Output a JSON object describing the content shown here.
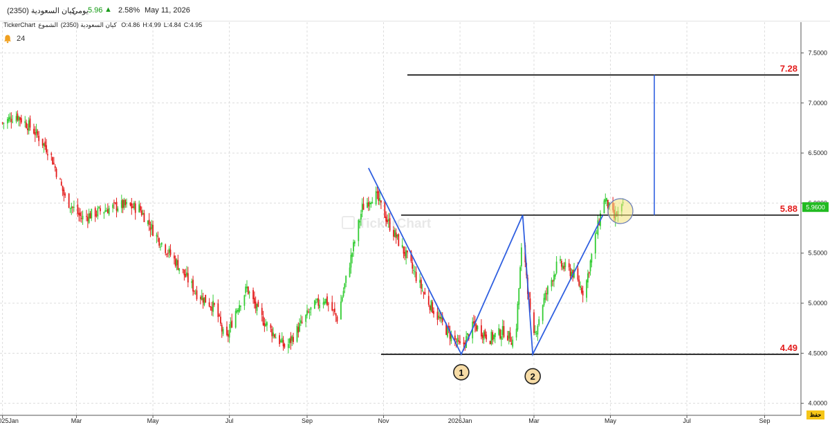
{
  "header": {
    "stock_name": "كيان السعودية (2350)",
    "period": "يومي",
    "price": "5.96",
    "change_pct": "2.58%",
    "date": "May 11, 2026"
  },
  "info_bar": {
    "brand": "TickerChart",
    "stock_label": "كيان السعودية (2350)",
    "type": "الشموع",
    "open": "O:4.86",
    "high": "H:4.99",
    "low": "L:4.84",
    "close": "C:4.95"
  },
  "alerts": {
    "count": "24"
  },
  "watermark": "TickerChart",
  "corner_button": "حفظ",
  "colors": {
    "up": "#33cc33",
    "down": "#e31b1b",
    "pattern": "#2f5fe0",
    "level_label": "#e31b1b",
    "price_tag": "#22bb22"
  },
  "chart_data": {
    "type": "candlestick",
    "x_range": [
      "2024-12-30",
      "2026-09-30"
    ],
    "ylim": [
      3.88,
      7.6
    ],
    "y_ticks": [
      "7.5000",
      "7.0000",
      "6.5000",
      "6.0000",
      "5.5000",
      "5.0000",
      "4.5000",
      "4.0000"
    ],
    "x_ticks": [
      {
        "label": "2025Jan",
        "date": "2025-01-01"
      },
      {
        "label": "Mar",
        "date": "2025-03-01"
      },
      {
        "label": "May",
        "date": "2025-05-01"
      },
      {
        "label": "Jul",
        "date": "2025-07-01"
      },
      {
        "label": "Sep",
        "date": "2025-09-01"
      },
      {
        "label": "Nov",
        "date": "2025-11-01"
      },
      {
        "label": "2026Jan",
        "date": "2026-01-01"
      },
      {
        "label": "Mar",
        "date": "2026-03-01"
      },
      {
        "label": "May",
        "date": "2026-05-01"
      },
      {
        "label": "Jul",
        "date": "2026-07-01"
      },
      {
        "label": "Sep",
        "date": "2026-09-01"
      }
    ],
    "price_path": [
      [
        "2025-01-01",
        6.8
      ],
      [
        "2025-01-12",
        6.88
      ],
      [
        "2025-01-25",
        6.74
      ],
      [
        "2025-02-08",
        6.5
      ],
      [
        "2025-02-20",
        6.05
      ],
      [
        "2025-03-05",
        5.85
      ],
      [
        "2025-03-20",
        5.92
      ],
      [
        "2025-04-05",
        5.98
      ],
      [
        "2025-04-20",
        5.95
      ],
      [
        "2025-05-05",
        5.65
      ],
      [
        "2025-05-20",
        5.4
      ],
      [
        "2025-06-05",
        5.1
      ],
      [
        "2025-06-20",
        4.95
      ],
      [
        "2025-06-28",
        4.6
      ],
      [
        "2025-07-05",
        4.9
      ],
      [
        "2025-07-15",
        5.15
      ],
      [
        "2025-07-25",
        4.88
      ],
      [
        "2025-08-05",
        4.7
      ],
      [
        "2025-08-15",
        4.55
      ],
      [
        "2025-08-25",
        4.75
      ],
      [
        "2025-09-05",
        4.95
      ],
      [
        "2025-09-15",
        5.05
      ],
      [
        "2025-09-25",
        4.85
      ],
      [
        "2025-10-05",
        5.4
      ],
      [
        "2025-10-15",
        5.95
      ],
      [
        "2025-10-25",
        6.1
      ],
      [
        "2025-11-05",
        5.8
      ],
      [
        "2025-11-20",
        5.45
      ],
      [
        "2025-12-05",
        5.05
      ],
      [
        "2025-12-20",
        4.75
      ],
      [
        "2026-01-02",
        4.55
      ],
      [
        "2026-01-12",
        4.78
      ],
      [
        "2026-01-25",
        4.65
      ],
      [
        "2026-02-05",
        4.72
      ],
      [
        "2026-02-14",
        4.6
      ],
      [
        "2026-02-20",
        5.7
      ],
      [
        "2026-02-28",
        4.6
      ],
      [
        "2026-03-08",
        5.0
      ],
      [
        "2026-03-20",
        5.4
      ],
      [
        "2026-04-01",
        5.3
      ],
      [
        "2026-04-10",
        5.1
      ],
      [
        "2026-04-18",
        5.6
      ],
      [
        "2026-04-26",
        6.05
      ],
      [
        "2026-05-04",
        5.85
      ],
      [
        "2026-05-11",
        5.96
      ]
    ],
    "pattern_line": [
      [
        "2025-10-20",
        6.35
      ],
      [
        "2026-01-02",
        4.49
      ],
      [
        "2026-02-20",
        5.88
      ],
      [
        "2026-02-28",
        4.49
      ],
      [
        "2026-04-25",
        5.88
      ]
    ],
    "levels": [
      {
        "label": "7.28",
        "value": 7.28,
        "from": "2025-11-20"
      },
      {
        "label": "5.88",
        "value": 5.88,
        "from": "2025-11-15"
      },
      {
        "label": "4.49",
        "value": 4.49,
        "from": "2025-10-30"
      }
    ],
    "target_line": {
      "date": "2026-06-05",
      "from": 5.88,
      "to": 7.28
    },
    "markers": [
      {
        "label": "1",
        "date": "2026-01-02",
        "value": 4.31
      },
      {
        "label": "2",
        "date": "2026-02-28",
        "value": 4.27
      }
    ],
    "breakout_circle": {
      "date": "2026-05-09",
      "value": 5.92
    },
    "last_price": {
      "label": "5.9600",
      "value": 5.96
    }
  }
}
